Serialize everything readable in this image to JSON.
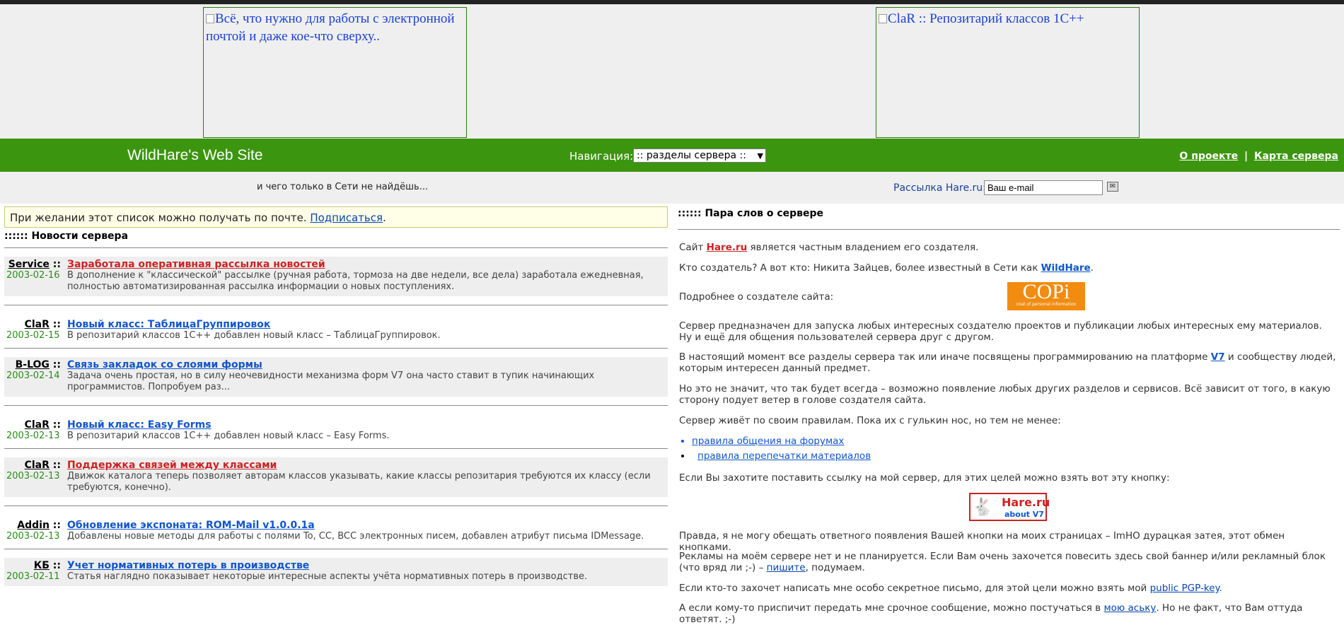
{
  "banners": [
    {
      "alt": "Всё, что нужно для работы с электронной почтой и даже кое-что сверху.."
    },
    {
      "alt": "ClaR :: Репозитарий классов 1С++"
    }
  ],
  "header": {
    "site_title": "WildHare's Web Site",
    "nav_label": "Навигация:",
    "nav_select_value": ":: разделы сервера ::",
    "about_link": "О проекте",
    "divider": "|",
    "sitemap_link": "Карта сервера"
  },
  "tagbar": {
    "tagline": "и чего только в Сети не найдёшь...",
    "subscribe_label": "Рассылка Hare.ru:",
    "subscribe_placeholder": "Ваш e-mail"
  },
  "left": {
    "notice_text": "При желании этот список можно получать по почте.",
    "notice_link": "Подписаться",
    "notice_dot": ".",
    "section_title": ":::::: Новости сервера",
    "news": [
      {
        "category": "Service",
        "date": "2003-02-16",
        "title": "Заработала оперативная рассылка новостей",
        "text": "В дополнение к \"классической\" рассылке (ручная работа, тормоза на две недели, все дела) заработала ежедневная, полностью автоматизированная рассылка информации о новых поступлениях."
      },
      {
        "category": "ClaR",
        "date": "2003-02-15",
        "title": "Новый класс: ТаблицаГруппировок",
        "text": "В репозитарий классов 1С++ добавлен новый класс – ТаблицаГруппировок."
      },
      {
        "category": "B-LOG",
        "date": "2003-02-14",
        "title": "Связь закладок со слоями формы",
        "text": "Задача очень простая, но в силу неочевидности механизма форм V7 она часто ставит в тупик начинающих программистов. Попробуем раз..."
      },
      {
        "category": "ClaR",
        "date": "2003-02-13",
        "title": "Новый класс: Easy Forms",
        "text": "В репозитарий классов 1С++ добавлен новый класс – Easy Forms."
      },
      {
        "category": "ClaR",
        "date": "2003-02-13",
        "title": "Поддержка связей между классами",
        "text": "Движок каталога теперь позволяет авторам классов указывать, какие классы репозитария требуются их классу (если требуются, конечно)."
      },
      {
        "category": "Addin",
        "date": "2003-02-13",
        "title": "Обновление экспоната: ROM-Mail v1.0.0.1a",
        "text": "Добавлены новые методы для работы с полями To, CC, BCC электронных писем, добавлен атрибут письма IDMessage."
      },
      {
        "category": "КБ",
        "date": "2003-02-11",
        "title": "Учет нормативных потерь в производстве",
        "text": "Статья наглядно показывает некоторые интересные аспекты учёта нормативных потерь в производстве."
      }
    ]
  },
  "right": {
    "section_title": ":::::: Пара слов о сервере",
    "p1_a": "Сайт ",
    "p1_link": "Hare.ru",
    "p1_b": " является частным владением его создателя.",
    "p2_a": "Кто создатель? А вот кто: Никита Зайцев, более известный в Сети как ",
    "p2_link": "WildHare",
    "p2_b": ".",
    "p3": "Подробнее о создателе сайта:",
    "copi_big": "COPi",
    "copi_small": "coat of personal information",
    "p4": "Сервер предназначен для запуска любых интересных создателю проектов и публикации любых интересных ему материалов. Ну и ещё для общения пользователей сервера друг с другом.",
    "p5_a": "В настоящий момент все разделы сервера так или иначе посвящены программированию на платформе ",
    "p5_link": "V7",
    "p5_b": " и сообществу людей, которым интересен данный предмет.",
    "p6": "Но это не значит, что так будет всегда – возможно появление любых других разделов и сервисов. Всё зависит от того, в какую сторону подует ветер в голове создателя сайта.",
    "p7": "Сервер живёт по своим правилам. Пока их с гулькин нос, но тем не менее:",
    "rules": [
      "правила общения на форумах",
      "правила перепечатки материалов"
    ],
    "p8": "Если Вы захотите поставить ссылку на мой сервер, для этих целей можно взять вот эту кнопку:",
    "hare_btn_a": "Hare.ru",
    "hare_btn_b": "about V7",
    "p9": "Правда, я не могу обещать ответного появления Вашей кнопки на моих страницах – ImHO дурацкая затея, этот обмен кнопками.",
    "p10_a": "Рекламы на моём сервере нет и не планируется. Если Вам очень захочется повесить здесь свой баннер и/или рекламный блок (что вряд ли ;-) – ",
    "p10_link": "пишите",
    "p10_b": ", подумаем.",
    "p11_a": "Если кто-то захочет написать мне особо секретное письмо, для этой цели можно взять мой ",
    "p11_link": "public PGP-key",
    "p11_b": ".",
    "p12_a": "А если кому-то приспичит передать мне срочное сообщение, можно постучаться в ",
    "p12_link": "мою аську",
    "p12_b": ". Но не факт, что Вам оттуда ответят. ;-)"
  },
  "colors": {
    "green": "#3c950f",
    "date_green": "#2a8c1a",
    "red_link": "#cc2222",
    "blue_link": "#1155cc"
  }
}
